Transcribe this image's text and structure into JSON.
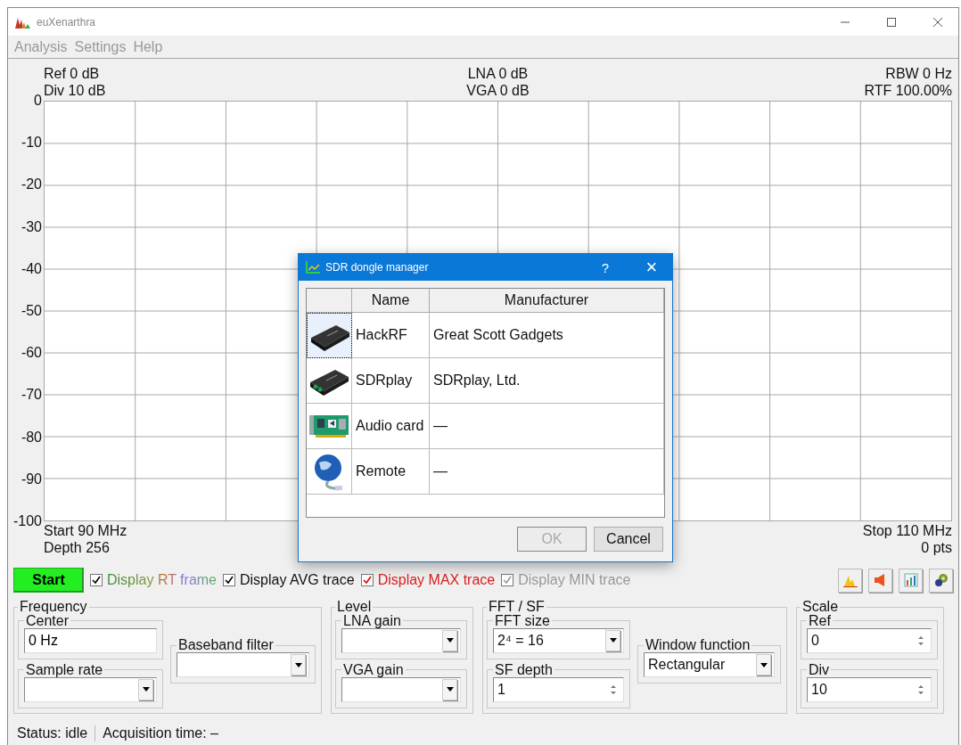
{
  "window": {
    "title": "euXenarthra"
  },
  "menu": [
    "Analysis",
    "Settings",
    "Help"
  ],
  "spectrum": {
    "top_left": [
      "Ref 0 dB",
      "Div 10 dB"
    ],
    "top_center": [
      "LNA 0 dB",
      "VGA 0 dB"
    ],
    "top_right": [
      "RBW 0 Hz",
      "RTF 100.00%"
    ],
    "y_labels": [
      "0",
      "-10",
      "-20",
      "-30",
      "-40",
      "-50",
      "-60",
      "-70",
      "-80",
      "-90",
      "-100"
    ],
    "bottom_left": [
      "Start 90 MHz",
      "Depth 256"
    ],
    "bottom_right": [
      "Stop 110 MHz",
      "0 pts"
    ]
  },
  "dialog": {
    "title": "SDR dongle manager",
    "help": "?",
    "close": "×",
    "columns": [
      "Name",
      "Manufacturer"
    ],
    "devices": [
      {
        "kind": "box",
        "name": "HackRF",
        "manufacturer": "Great Scott Gadgets",
        "selected": true
      },
      {
        "kind": "box-green",
        "name": "SDRplay",
        "manufacturer": "SDRplay, Ltd.",
        "selected": false
      },
      {
        "kind": "card",
        "name": "Audio card",
        "manufacturer": "—",
        "selected": false
      },
      {
        "kind": "globe",
        "name": "Remote",
        "manufacturer": "—",
        "selected": false
      }
    ],
    "buttons": [
      {
        "label": "OK",
        "disabled": true
      },
      {
        "label": "Cancel",
        "disabled": false
      }
    ]
  },
  "start_button": "Start",
  "checkboxes": [
    {
      "label": "Display RT frame",
      "kind": "rainbow",
      "checked": true,
      "disabled": false
    },
    {
      "label": "Display AVG trace",
      "kind": "plain",
      "checked": true,
      "disabled": false
    },
    {
      "label": "Display MAX trace",
      "kind": "red",
      "checked": true,
      "disabled": false
    },
    {
      "label": "Display MIN trace",
      "kind": "plain",
      "checked": true,
      "disabled": true
    }
  ],
  "toolbar": [
    {
      "kind": "peak"
    },
    {
      "kind": "speaker"
    },
    {
      "kind": "bars"
    },
    {
      "kind": "gears"
    }
  ],
  "groups": [
    {
      "title": "Frequency",
      "columns": [
        [
          {
            "label": "Center",
            "kind": "text",
            "value": "0 Hz"
          },
          {
            "label": "Sample rate",
            "kind": "combo"
          }
        ],
        [
          {
            "label": "Baseband filter",
            "kind": "combo"
          }
        ]
      ]
    },
    {
      "title": "Level",
      "columns": [
        [
          {
            "label": "LNA gain",
            "kind": "combo"
          },
          {
            "label": "VGA gain",
            "kind": "combo"
          }
        ]
      ]
    },
    {
      "title": "FFT / SF",
      "columns": [
        [
          {
            "label": "FFT size",
            "kind": "combo",
            "value": "2⁴ = 16"
          },
          {
            "label": "SF depth",
            "kind": "spin",
            "value": "1"
          }
        ],
        [
          {
            "label": "Window function",
            "kind": "combo",
            "value": "Rectangular"
          }
        ]
      ]
    },
    {
      "title": "Scale",
      "columns": [
        [
          {
            "label": "Ref",
            "kind": "spin",
            "value": "0"
          },
          {
            "label": "Div",
            "kind": "spin",
            "value": "10"
          }
        ]
      ]
    }
  ],
  "status_bar": [
    "Status: idle",
    "Acquisition time: –"
  ]
}
